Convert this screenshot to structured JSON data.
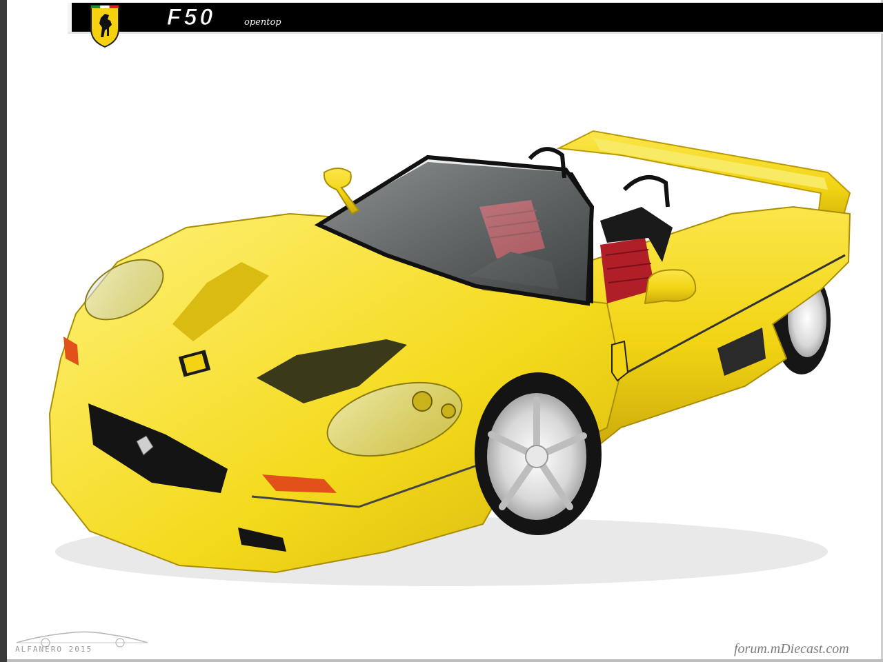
{
  "header": {
    "title": "F50",
    "subtitle": "opentop",
    "badge_icon": "prancing-horse-shield-icon"
  },
  "photo": {
    "subject": "yellow-convertible-sports-car-model",
    "colors": {
      "body": "#f2d414",
      "body_shadow": "#c9a90c",
      "interior_red": "#b01e28",
      "seat_black": "#1a1a1a",
      "wheel_silver": "#dcdcdc",
      "background": "#ffffff"
    }
  },
  "watermarks": {
    "left": "ALFANERO 2015",
    "right": "forum.mDiecast.com"
  }
}
